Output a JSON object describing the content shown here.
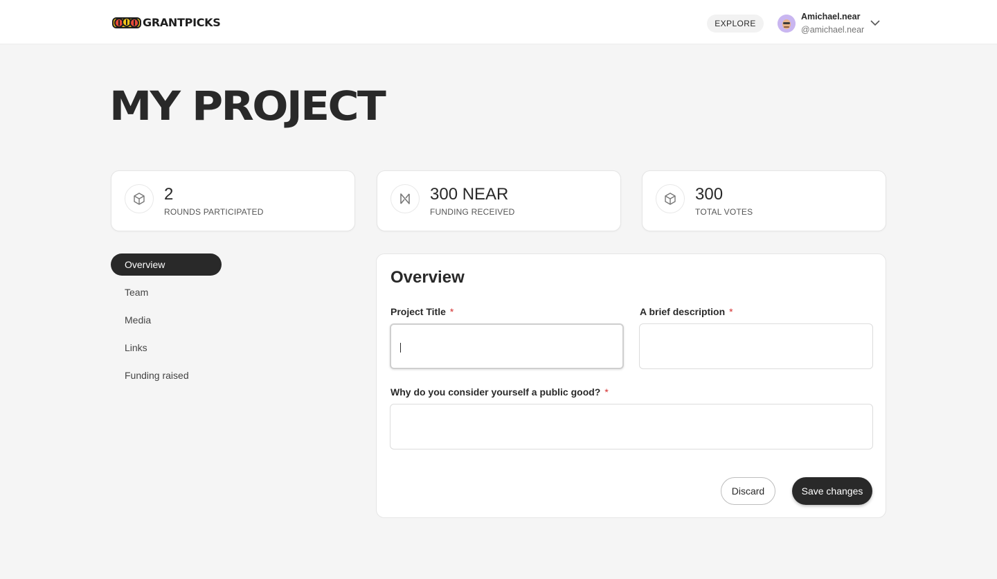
{
  "header": {
    "logo_text": "GRANTPICKS",
    "logo_icon": "grantpicks-logo",
    "explore_label": "EXPLORE",
    "user": {
      "name": "Amichael.near",
      "handle": "@amichael.near",
      "avatar_color": "#c9b6f0"
    }
  },
  "page": {
    "title": "MY PROJECT"
  },
  "stats": [
    {
      "value": "2",
      "label": "ROUNDS PARTICIPATED",
      "icon": "cube-icon"
    },
    {
      "value": "300 NEAR",
      "label": "FUNDING RECEIVED",
      "icon": "near-icon"
    },
    {
      "value": "300",
      "label": "TOTAL VOTES",
      "icon": "cube-icon"
    }
  ],
  "sidebar": {
    "items": [
      {
        "label": "Overview",
        "active": true
      },
      {
        "label": "Team",
        "active": false
      },
      {
        "label": "Media",
        "active": false
      },
      {
        "label": "Links",
        "active": false
      },
      {
        "label": "Funding raised",
        "active": false
      }
    ]
  },
  "form": {
    "title": "Overview",
    "required_mark": "*",
    "fields": {
      "project_title": {
        "label": "Project Title",
        "value": ""
      },
      "description": {
        "label": "A brief description",
        "value": ""
      },
      "public_good": {
        "label": "Why do you consider yourself a public good?",
        "value": ""
      }
    },
    "discard_label": "Discard",
    "save_label": "Save changes"
  },
  "colors": {
    "accent_dark": "#292929",
    "required": "#d32f2f",
    "background": "#f5f5f5"
  }
}
